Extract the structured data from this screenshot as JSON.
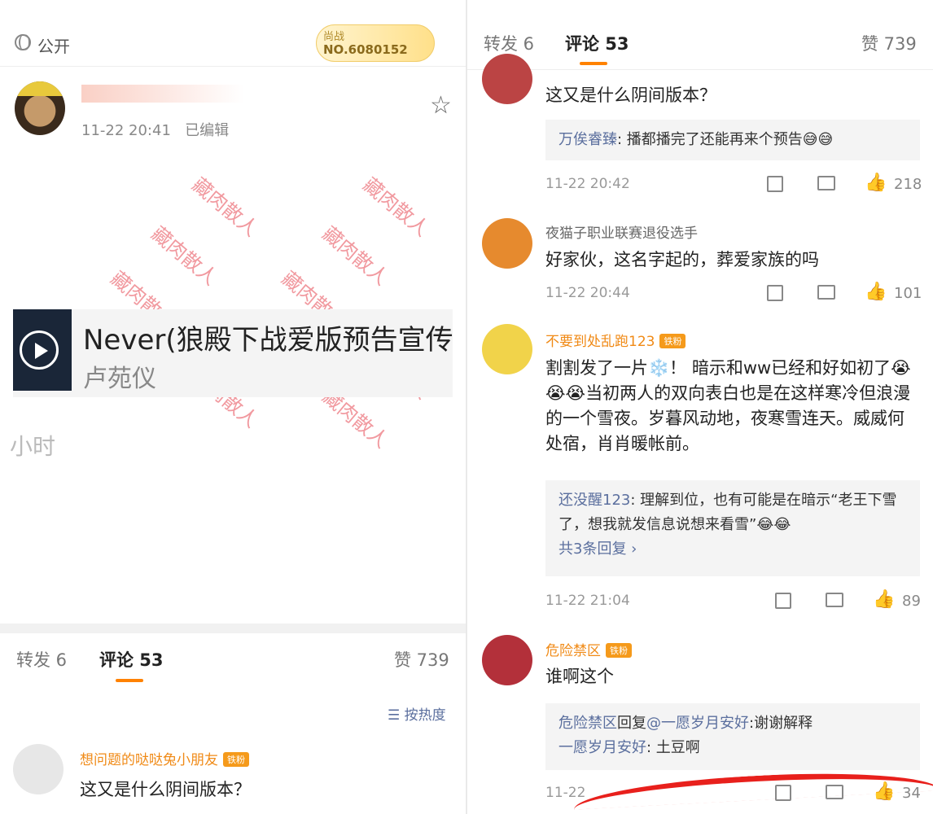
{
  "left": {
    "visibility": "公开",
    "badge": {
      "line1": "尚战",
      "line2": "NO.6080152"
    },
    "post_time": "11-22 20:41",
    "edited": "已编辑",
    "watermark": "藏肉散人",
    "card": {
      "title": "Never(狼殿下战爱版预告宣传",
      "subtitle": "卢苑仪"
    },
    "fragment": "小时",
    "tabs": {
      "repost": "转发 6",
      "comments": "评论 53",
      "likes": "赞 739"
    },
    "sort": "按热度",
    "first_comment": {
      "name": "想问题的哒哒兔小朋友",
      "fan_badge": "铁粉",
      "text": "这又是什么阴间版本？"
    }
  },
  "right": {
    "tabs": {
      "repost": "转发 6",
      "comments": "评论 53",
      "likes": "赞 739"
    },
    "comments": [
      {
        "name": "想问题的哒哒兔小朋友",
        "text": "这又是什么阴间版本？",
        "reply_who": "万俟睿臻",
        "reply_text": ":  播都播完了还能再来个预告😅😅",
        "time": "11-22 20:42",
        "likes": "218"
      },
      {
        "name": "夜猫子职业联赛退役选手",
        "text": "好家伙，这名字起的，葬爱家族的吗",
        "time": "11-22 20:44",
        "likes": "101"
      },
      {
        "name": "不要到处乱跑123",
        "fan_badge": "铁粉",
        "text": "割割发了一片❄️！ 暗示和ww已经和好如初了😭😭😭当初两人的双向表白也是在这样寒冷但浪漫的一个雪夜。岁暮风动地，夜寒雪连天。威威何处宿，肖肖暖帐前。",
        "reply_who": "还没醒123",
        "reply_text": ":  理解到位，也有可能是在暗示“老王下雪了，想我就发信息说想来看雪”😂😂",
        "more": "共3条回复 ›",
        "time": "11-22 21:04",
        "likes": "89"
      },
      {
        "name": "危险禁区",
        "fan_badge": "铁粉",
        "text": "谁啊这个",
        "reply_line1_who": "危险禁区",
        "reply_line1_mid": "回复",
        "reply_line1_at": "@一愿岁月安好",
        "reply_line1_text": ":谢谢解释",
        "reply_line2_who": "一愿岁月安好",
        "reply_line2_text": ":  土豆啊",
        "time": "11-22",
        "likes": "34"
      }
    ]
  },
  "colors": {
    "accent": "#ff8200",
    "link": "#5b6f9e",
    "name_orange": "#f08a16"
  }
}
